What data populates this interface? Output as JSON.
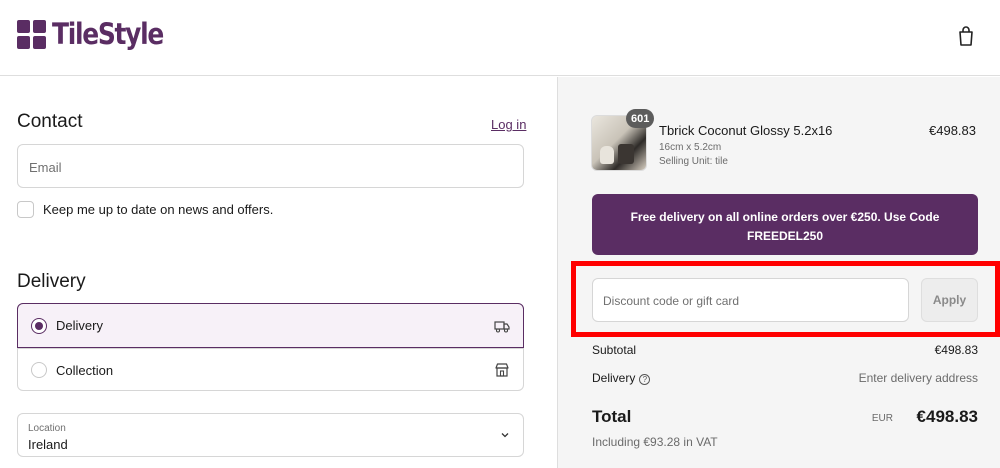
{
  "header": {
    "brand": "TileStyle",
    "brand_color": "#5a2d63",
    "cart_icon": "shopping-bag-icon"
  },
  "contact": {
    "title": "Contact",
    "login_link": "Log in",
    "email_placeholder": "Email",
    "newsletter_label": "Keep me up to date on news and offers."
  },
  "delivery": {
    "title": "Delivery",
    "options": [
      {
        "label": "Delivery",
        "selected": true,
        "icon": "truck-icon"
      },
      {
        "label": "Collection",
        "selected": false,
        "icon": "store-icon"
      }
    ],
    "location_label": "Location",
    "location_value": "Ireland"
  },
  "order": {
    "item": {
      "quantity": "601",
      "name": "Tbrick Coconut Glossy 5.2x16",
      "size": "16cm x 5.2cm",
      "unit": "Selling Unit: tile",
      "price": "€498.83"
    },
    "promo_text": "Free delivery on all online orders over €250. Use Code FREEDEL250",
    "discount_placeholder": "Discount code or gift card",
    "apply_label": "Apply",
    "subtotal_label": "Subtotal",
    "subtotal_value": "€498.83",
    "delivery_label": "Delivery",
    "delivery_value": "Enter delivery address",
    "total_label": "Total",
    "total_currency": "EUR",
    "total_value": "€498.83",
    "vat_text": "Including €93.28 in VAT"
  }
}
